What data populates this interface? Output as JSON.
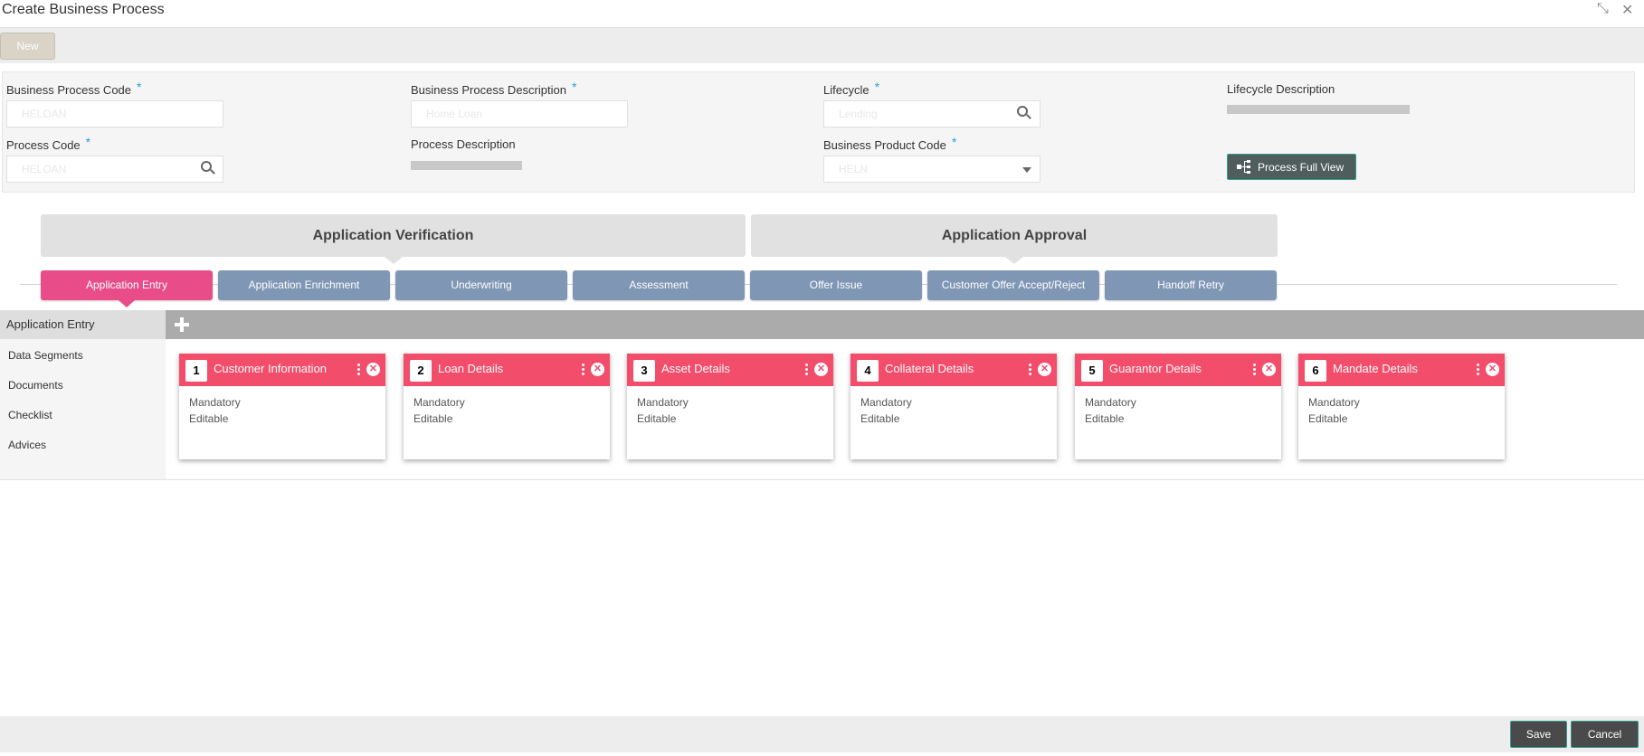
{
  "window": {
    "title": "Create Business Process",
    "minimize_glyph": "⤡",
    "close_glyph": "✕"
  },
  "toolbar": {
    "new_label": "New"
  },
  "form": {
    "business_process_code": {
      "label": "Business Process Code",
      "required": "*",
      "value": "HELOAN"
    },
    "business_process_description": {
      "label": "Business Process Description",
      "required": "*",
      "value": "Home Loan"
    },
    "lifecycle": {
      "label": "Lifecycle",
      "required": "*",
      "value": "Lending"
    },
    "lifecycle_description": {
      "label": "Lifecycle Description"
    },
    "process_code": {
      "label": "Process Code",
      "required": "*",
      "value": "HELOAN"
    },
    "process_description": {
      "label": "Process Description"
    },
    "business_product_code": {
      "label": "Business Product Code",
      "required": "*",
      "value": "HELN"
    },
    "process_full_view_label": "Process Full View"
  },
  "stages": [
    {
      "label": "Application Verification"
    },
    {
      "label": "Application Approval"
    }
  ],
  "steps": [
    {
      "label": "Application Entry",
      "active": true
    },
    {
      "label": "Application Enrichment"
    },
    {
      "label": "Underwriting"
    },
    {
      "label": "Assessment"
    },
    {
      "label": "Offer Issue"
    },
    {
      "label": "Customer Offer Accept/Reject"
    },
    {
      "label": "Handoff Retry"
    }
  ],
  "side_menu": {
    "header": "Application Entry",
    "items": [
      "Data Segments",
      "Documents",
      "Checklist",
      "Advices"
    ]
  },
  "cards": [
    {
      "num": "1",
      "title": "Customer Information",
      "line1": "Mandatory",
      "line2": "Editable"
    },
    {
      "num": "2",
      "title": "Loan Details",
      "line1": "Mandatory",
      "line2": "Editable"
    },
    {
      "num": "3",
      "title": "Asset Details",
      "line1": "Mandatory",
      "line2": "Editable"
    },
    {
      "num": "4",
      "title": "Collateral Details",
      "line1": "Mandatory",
      "line2": "Editable"
    },
    {
      "num": "5",
      "title": "Guarantor Details",
      "line1": "Mandatory",
      "line2": "Editable"
    },
    {
      "num": "6",
      "title": "Mandate Details",
      "line1": "Mandatory",
      "line2": "Editable"
    }
  ],
  "footer": {
    "save_label": "Save",
    "cancel_label": "Cancel"
  },
  "colors": {
    "accent_active_step": "#e84d8a",
    "step": "#7f96b5",
    "card_header": "#f24d6a",
    "required": "#2a9fd6"
  }
}
